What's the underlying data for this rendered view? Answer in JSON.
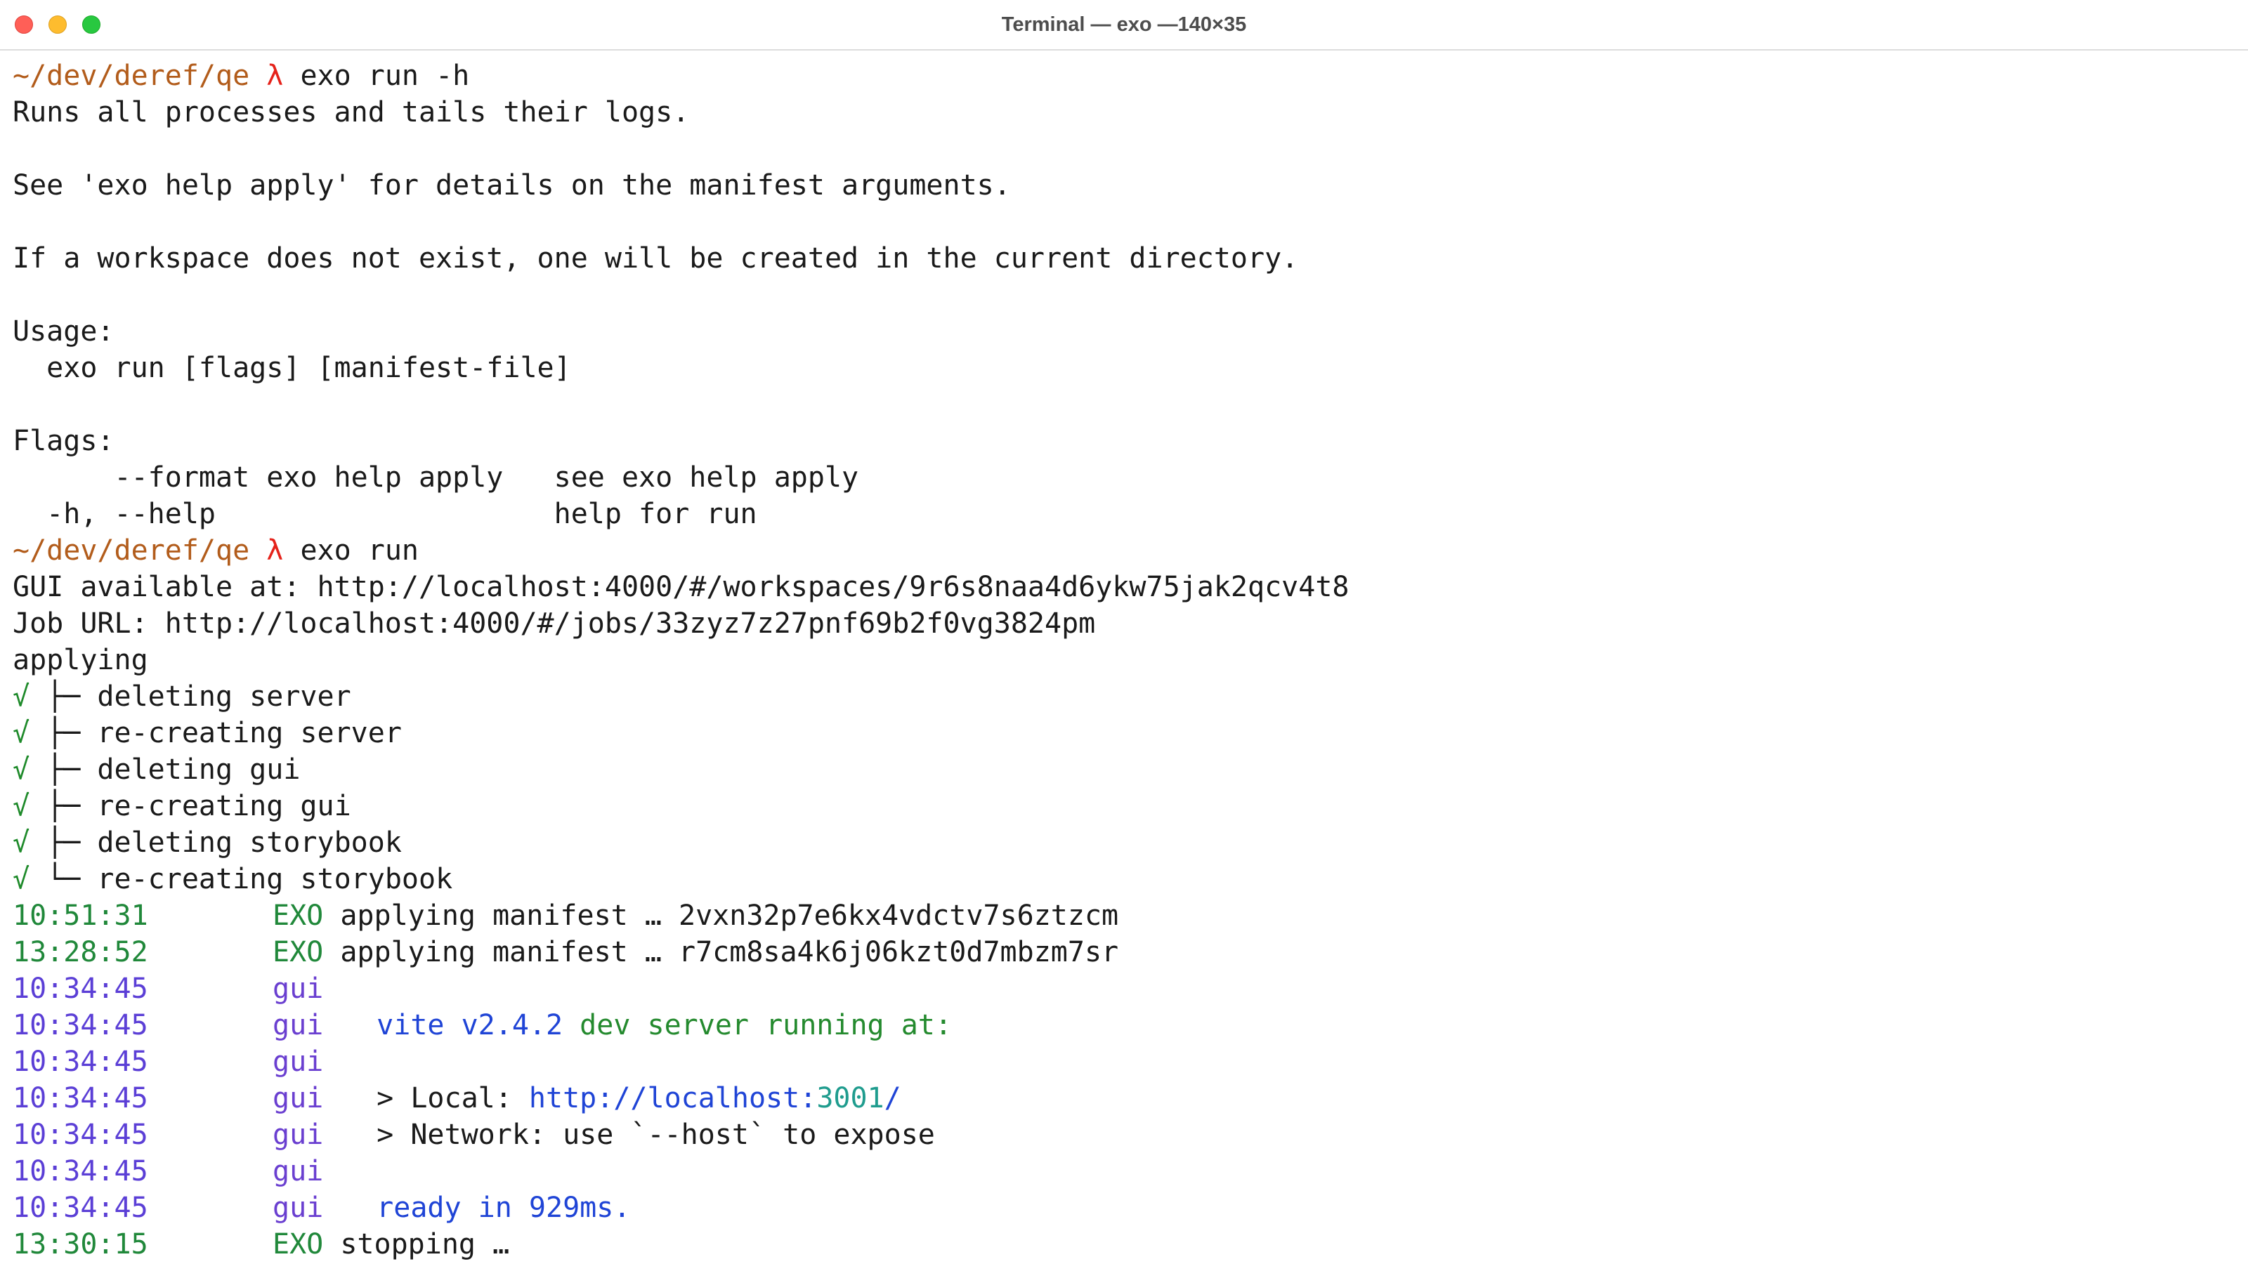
{
  "window": {
    "title": "Terminal — exo —140×35"
  },
  "prompt": {
    "path": "~/dev/deref/qe",
    "symbol": "λ"
  },
  "help": {
    "cmd1": "exo run -h",
    "desc1": "Runs all processes and tails their logs.",
    "desc2": "See 'exo help apply' for details on the manifest arguments.",
    "desc3": "If a workspace does not exist, one will be created in the current directory.",
    "usage_header": "Usage:",
    "usage_line": "  exo run [flags] [manifest-file]",
    "flags_header": "Flags:",
    "flag1": "      --format exo help apply   see exo help apply",
    "flag2": "  -h, --help                    help for run"
  },
  "run": {
    "cmd2": "exo run",
    "gui_url": "GUI available at: http://localhost:4000/#/workspaces/9r6s8naa4d6ykw75jak2qcv4t8",
    "job_url": "Job URL: http://localhost:4000/#/jobs/33zyz7z27pnf69b2f0vg3824pm",
    "applying": "applying",
    "check": "√",
    "steps": [
      " ├─ deleting server",
      " ├─ re-creating server",
      " ├─ deleting gui",
      " ├─ re-creating gui",
      " ├─ deleting storybook",
      " └─ re-creating storybook"
    ]
  },
  "logs": [
    {
      "time": "10:51:31",
      "source": "EXO",
      "text": "applying manifest … 2vxn32p7e6kx4vdctv7s6ztzcm"
    },
    {
      "time": "13:28:52",
      "source": "EXO",
      "text": "applying manifest … r7cm8sa4k6j06kzt0d7mbzm7sr"
    },
    {
      "time": "10:34:45",
      "source": "gui",
      "text": ""
    },
    {
      "time": "10:34:45",
      "source": "gui",
      "text": "  vite v2.4.2",
      "text2": " dev server running at:"
    },
    {
      "time": "10:34:45",
      "source": "gui",
      "text": ""
    },
    {
      "time": "10:34:45",
      "source": "gui",
      "text": "  > Local: ",
      "url_prefix": "http://localhost:",
      "url_port": "3001",
      "url_suffix": "/"
    },
    {
      "time": "10:34:45",
      "source": "gui",
      "text": "  > Network: use `--host` to expose"
    },
    {
      "time": "10:34:45",
      "source": "gui",
      "text": ""
    },
    {
      "time": "10:34:45",
      "source": "gui",
      "text": "  ready in 929ms."
    },
    {
      "time": "13:30:15",
      "source": "EXO",
      "text": "stopping …"
    }
  ],
  "colors": {
    "path": "#b25c1b",
    "lambda": "#e5221a",
    "check": "#1e8a2a",
    "exo_time": "#20883a",
    "gui_time": "#5b3fd6",
    "link": "#1f44d6"
  }
}
